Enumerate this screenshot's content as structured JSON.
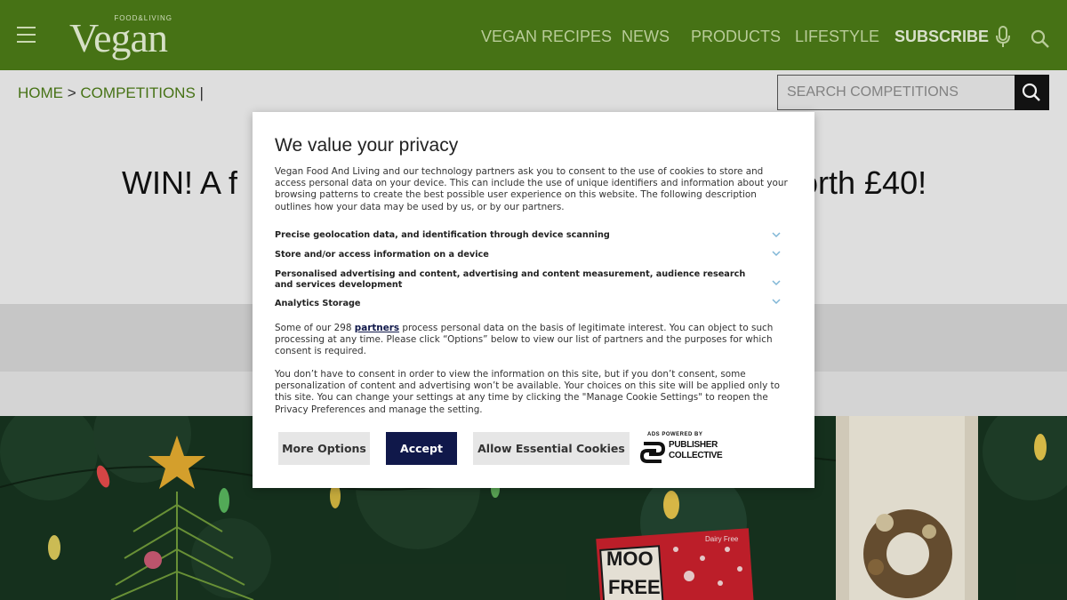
{
  "header": {
    "logo_small": "FOOD&LIVING",
    "logo_main": "Vegan",
    "nav": [
      {
        "label": "VEGAN RECIPES"
      },
      {
        "label": "NEWS"
      },
      {
        "label": "PRODUCTS"
      },
      {
        "label": "LIFESTYLE"
      },
      {
        "label": "SUBSCRIBE"
      }
    ]
  },
  "breadcrumb": {
    "home": "HOME",
    "separator": ">",
    "current": "COMPETITIONS",
    "trailing": "|"
  },
  "search": {
    "placeholder": "SEARCH COMPETITIONS"
  },
  "headline": {
    "left": "WIN! A f",
    "right": "orth £40!"
  },
  "hero": {
    "product_text_1": "MOO",
    "product_text_2": "FREE",
    "product_tag": "Dairy Free"
  },
  "consent": {
    "title": "We value your privacy",
    "intro": "Vegan Food And Living and our technology partners ask you to consent to the use of cookies to store and access personal data on your device. This can include the use of unique identifiers and information about your browsing patterns to create the best possible user experience on this website. The following description outlines how your data may be used by us, or by our partners.",
    "purposes": [
      {
        "label": "Precise geolocation data, and identification through device scanning"
      },
      {
        "label": "Store and/or access information on a device"
      },
      {
        "label": "Personalised advertising and content, advertising and content measurement, audience research and services development"
      },
      {
        "label": "Analytics Storage"
      }
    ],
    "partners_prefix": "Some of our 298 ",
    "partners_link": "partners",
    "partners_suffix": " process personal data on the basis of legitimate interest. You can object to such processing at any time. Please click “Options” below to view our list of partners and the purposes for which consent is required.",
    "choice_text": "You don’t have to consent in order to view the information on this site, but if you don’t consent, some personalization of content and advertising won’t be available. Your choices on this site will be applied only to this site. You can change your settings at any time by clicking the \"Manage Cookie Settings\" to reopen the Privacy Preferences and manage the setting.",
    "buttons": {
      "more_options": "More Options",
      "accept": "Accept",
      "essential": "Allow Essential Cookies"
    },
    "ads_powered_by": "ADS POWERED BY",
    "publisher_line1": "PUBLISHER",
    "publisher_line2": "COLLECTIVE"
  },
  "colors": {
    "header_green": "#4b7a17",
    "accept_navy": "#10184a",
    "hero_dark_green": "#17331f"
  }
}
